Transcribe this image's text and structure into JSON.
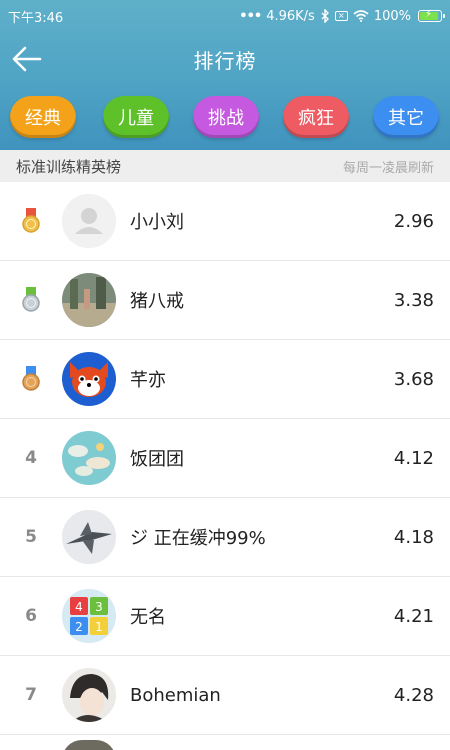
{
  "status": {
    "time": "下午3:46",
    "speed": "4.96K/s",
    "battery": "100%"
  },
  "header": {
    "title": "排行榜"
  },
  "categories": [
    "经典",
    "儿童",
    "挑战",
    "疯狂",
    "其它"
  ],
  "subbar": {
    "left": "标准训练精英榜",
    "right": "每周一凌晨刷新"
  },
  "rows": [
    {
      "rank": "1",
      "name": "小小刘",
      "score": "2.96"
    },
    {
      "rank": "2",
      "name": "猪八戒",
      "score": "3.38"
    },
    {
      "rank": "3",
      "name": "芊亦",
      "score": "3.68"
    },
    {
      "rank": "4",
      "name": "饭团团",
      "score": "4.12"
    },
    {
      "rank": "5",
      "name": "ジ 正在缓冲99%",
      "score": "4.18"
    },
    {
      "rank": "6",
      "name": "无名",
      "score": "4.21"
    },
    {
      "rank": "7",
      "name": "Bohemian",
      "score": "4.28"
    }
  ],
  "colors": {
    "gold": "#f1c04a",
    "silver": "#c9d0d6",
    "bronze": "#e4a35a"
  }
}
